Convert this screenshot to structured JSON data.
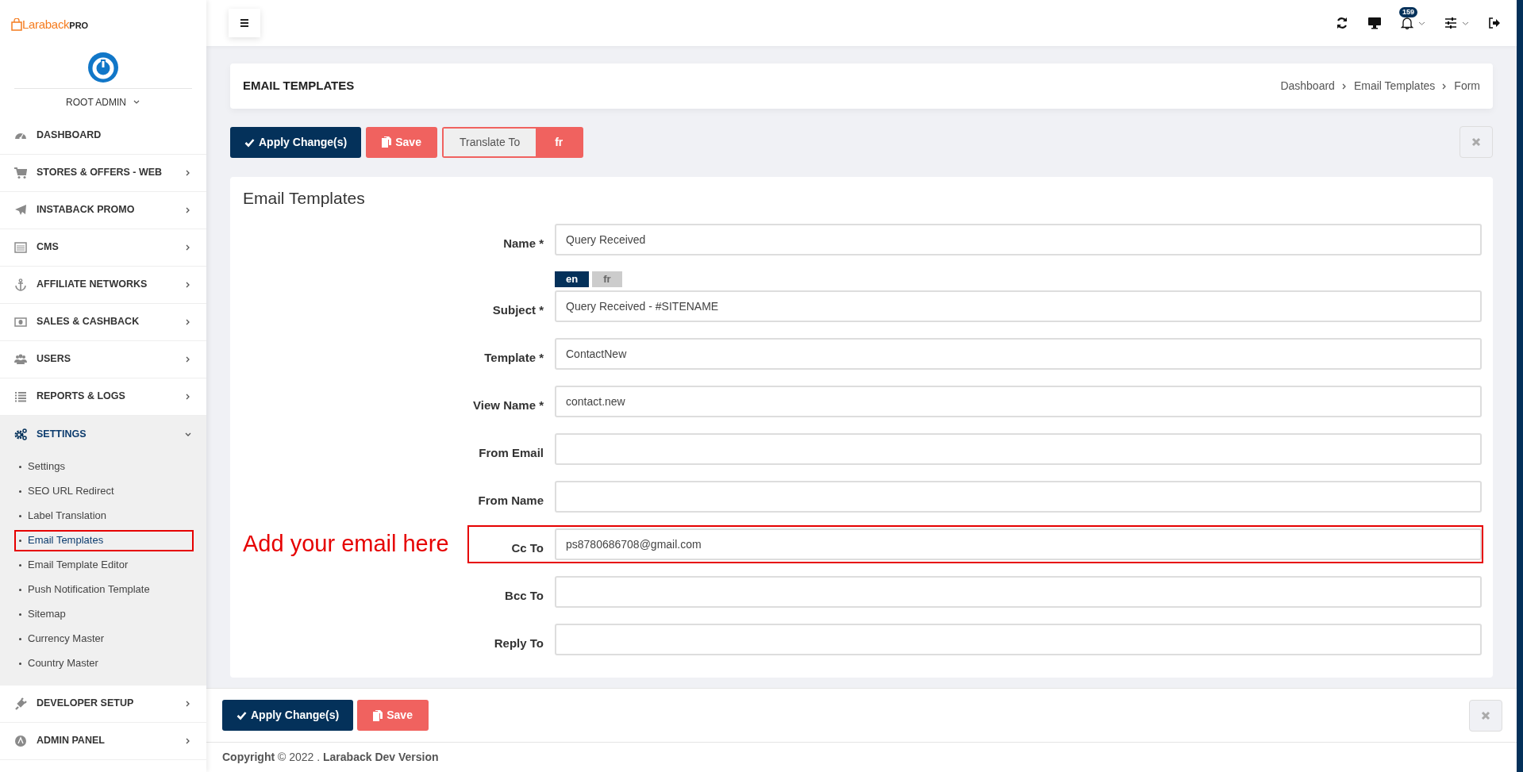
{
  "logo": {
    "brand": "Laraback",
    "suffix": "PRO"
  },
  "user": {
    "name": "ROOT ADMIN"
  },
  "sidebar": {
    "items": [
      {
        "label": "DASHBOARD"
      },
      {
        "label": "STORES & OFFERS - WEB",
        "expanded": false
      },
      {
        "label": "INSTABACK PROMO",
        "expanded": false
      },
      {
        "label": "CMS",
        "expanded": false
      },
      {
        "label": "AFFILIATE NETWORKS",
        "expanded": false
      },
      {
        "label": "SALES & CASHBACK",
        "expanded": false
      },
      {
        "label": "USERS",
        "expanded": false
      },
      {
        "label": "REPORTS & LOGS",
        "expanded": false
      },
      {
        "label": "SETTINGS",
        "expanded": true,
        "children": [
          {
            "label": "Settings",
            "selected": false,
            "highlighted": false
          },
          {
            "label": "SEO URL Redirect",
            "selected": false,
            "highlighted": false
          },
          {
            "label": "Label Translation",
            "selected": false,
            "highlighted": false
          },
          {
            "label": "Email Templates",
            "selected": true,
            "highlighted": true
          },
          {
            "label": "Email Template Editor",
            "selected": false,
            "highlighted": false
          },
          {
            "label": "Push Notification Template",
            "selected": false,
            "highlighted": false
          },
          {
            "label": "Sitemap",
            "selected": false,
            "highlighted": false
          },
          {
            "label": "Currency Master",
            "selected": false,
            "highlighted": false
          },
          {
            "label": "Country Master",
            "selected": false,
            "highlighted": false
          }
        ]
      },
      {
        "label": "DEVELOPER SETUP",
        "expanded": false
      },
      {
        "label": "ADMIN PANEL",
        "expanded": false
      }
    ]
  },
  "topbar": {
    "notification_count": "159"
  },
  "page_header": {
    "title": "EMAIL TEMPLATES",
    "breadcrumb": [
      "Dashboard",
      "Email Templates",
      "Form"
    ]
  },
  "toolbar": {
    "apply": "Apply Change(s)",
    "save": "Save",
    "translate_label": "Translate To",
    "translate_lang": "fr"
  },
  "form": {
    "title": "Email Templates",
    "fields": [
      {
        "label": "Name *",
        "value": "Query Received",
        "highlighted": false
      },
      {
        "label": "Subject *",
        "value": "Query Received - #SITENAME",
        "highlighted": false,
        "languages": [
          {
            "label": "en",
            "selected": true
          },
          {
            "label": "fr",
            "selected": false
          }
        ]
      },
      {
        "label": "Template *",
        "value": "ContactNew",
        "highlighted": false
      },
      {
        "label": "View Name *",
        "value": "contact.new",
        "highlighted": false
      },
      {
        "label": "From Email",
        "highlighted": false
      },
      {
        "label": "From Name",
        "highlighted": false
      },
      {
        "label": "Cc To",
        "value": "ps8780686708@gmail.com",
        "highlighted": true,
        "annotation": "Add your email here"
      },
      {
        "label": "Bcc To",
        "highlighted": false
      },
      {
        "label": "Reply To",
        "highlighted": false
      }
    ]
  },
  "bottom_bar": {
    "apply": "Apply Change(s)",
    "save": "Save"
  },
  "footer": {
    "text": "**Copyright** © 2022 . **Laraback Dev Version**"
  }
}
